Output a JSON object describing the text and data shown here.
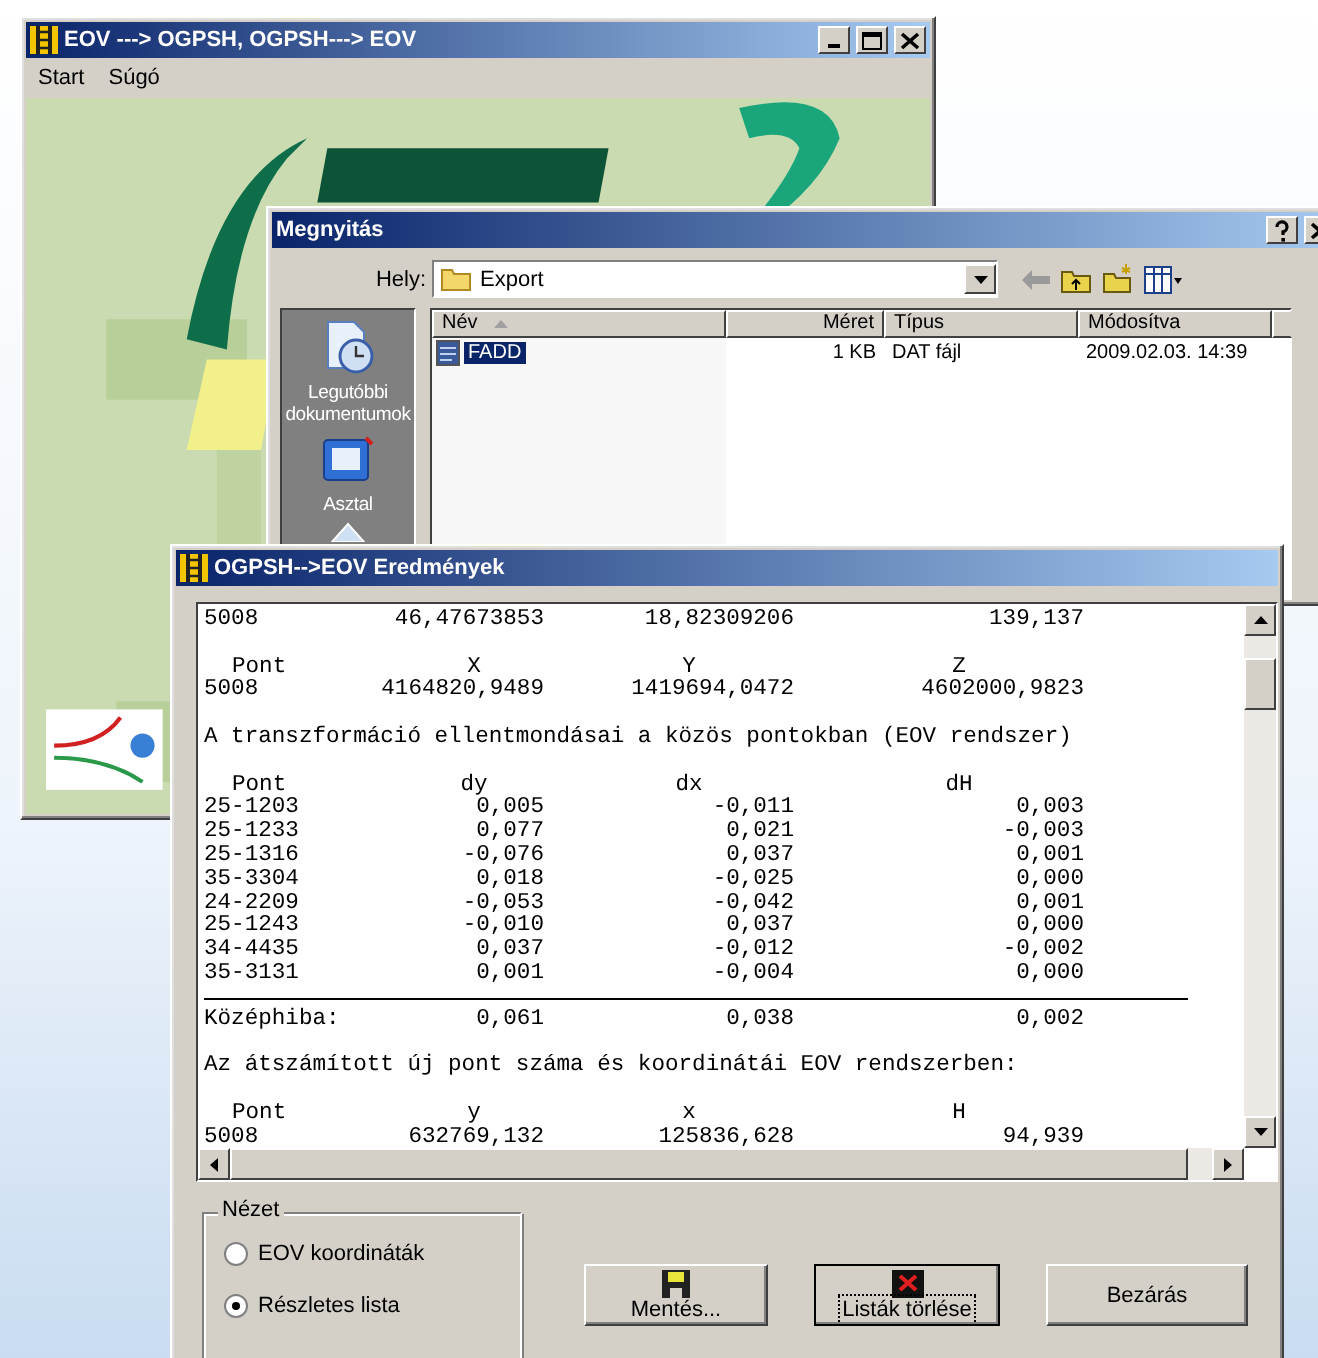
{
  "main_window": {
    "title": "EOV ---> OGPSH, OGPSH---> EOV",
    "menu": [
      "Start",
      "Súgó"
    ],
    "splash": {
      "kind": "picture"
    }
  },
  "open_dialog": {
    "title": "Megnyitás",
    "location_label": "Hely:",
    "location": "Export",
    "places": [
      {
        "label": "Legutóbbi dokumentumok",
        "kind": "recent"
      },
      {
        "label": "Asztal",
        "kind": "desktop"
      }
    ],
    "columns": [
      "Név",
      "Méret",
      "Típus",
      "Módosítva"
    ],
    "files": [
      {
        "name": "FADD",
        "size": "1 KB",
        "type": "DAT fájl",
        "modified": "2009.02.03. 14:39",
        "selected": true
      }
    ]
  },
  "results_window": {
    "title": "OGPSH-->EOV Eredmények",
    "lines": [
      {
        "kind": "row",
        "cells": [
          "5008",
          "46,47673853",
          "18,82309206",
          "139,137"
        ]
      },
      {
        "kind": "blank"
      },
      {
        "kind": "header",
        "cells": [
          "Pont",
          "X",
          "Y",
          "Z"
        ]
      },
      {
        "kind": "row",
        "cells": [
          "5008",
          "4164820,9489",
          "1419694,0472",
          "4602000,9823"
        ]
      },
      {
        "kind": "blank"
      },
      {
        "kind": "text",
        "text": "A transzformáció ellentmondásai a közös pontokban (EOV rendszer)"
      },
      {
        "kind": "blank"
      },
      {
        "kind": "header",
        "cells": [
          "Pont",
          "dy",
          "dx",
          "dH"
        ]
      },
      {
        "kind": "row",
        "cells": [
          "25-1203",
          "0,005",
          "-0,011",
          "0,003"
        ]
      },
      {
        "kind": "row",
        "cells": [
          "25-1233",
          "0,077",
          "0,021",
          "-0,003"
        ]
      },
      {
        "kind": "row",
        "cells": [
          "25-1316",
          "-0,076",
          "0,037",
          "0,001"
        ]
      },
      {
        "kind": "row",
        "cells": [
          "35-3304",
          "0,018",
          "-0,025",
          "0,000"
        ]
      },
      {
        "kind": "row",
        "cells": [
          "24-2209",
          "-0,053",
          "-0,042",
          "0,001"
        ]
      },
      {
        "kind": "row",
        "cells": [
          "25-1243",
          "-0,010",
          "0,037",
          "0,000"
        ]
      },
      {
        "kind": "row",
        "cells": [
          "34-4435",
          "0,037",
          "-0,012",
          "-0,002"
        ]
      },
      {
        "kind": "row",
        "cells": [
          "35-3131",
          "0,001",
          "-0,004",
          "0,000"
        ]
      },
      {
        "kind": "rule"
      },
      {
        "kind": "row",
        "cells": [
          "Középhiba:",
          "0,061",
          "0,038",
          "0,002"
        ]
      },
      {
        "kind": "blank"
      },
      {
        "kind": "text",
        "text": "Az átszámított új pont száma és koordinátái EOV rendszerben:"
      },
      {
        "kind": "blank"
      },
      {
        "kind": "header",
        "cells": [
          "Pont",
          "y",
          "x",
          "H"
        ]
      },
      {
        "kind": "row",
        "cells": [
          "5008",
          "632769,132",
          "125836,628",
          "94,939"
        ]
      }
    ],
    "view_group": {
      "title": "Nézet",
      "options": [
        {
          "label": "EOV koordináták",
          "selected": false
        },
        {
          "label": "Részletes lista",
          "selected": true
        }
      ]
    },
    "buttons": [
      {
        "label": "Mentés...",
        "kind": "save",
        "focused": false
      },
      {
        "label": "Listák törlése",
        "kind": "delete",
        "focused": true
      },
      {
        "label": "Bezárás",
        "kind": "plain",
        "focused": false
      }
    ]
  }
}
